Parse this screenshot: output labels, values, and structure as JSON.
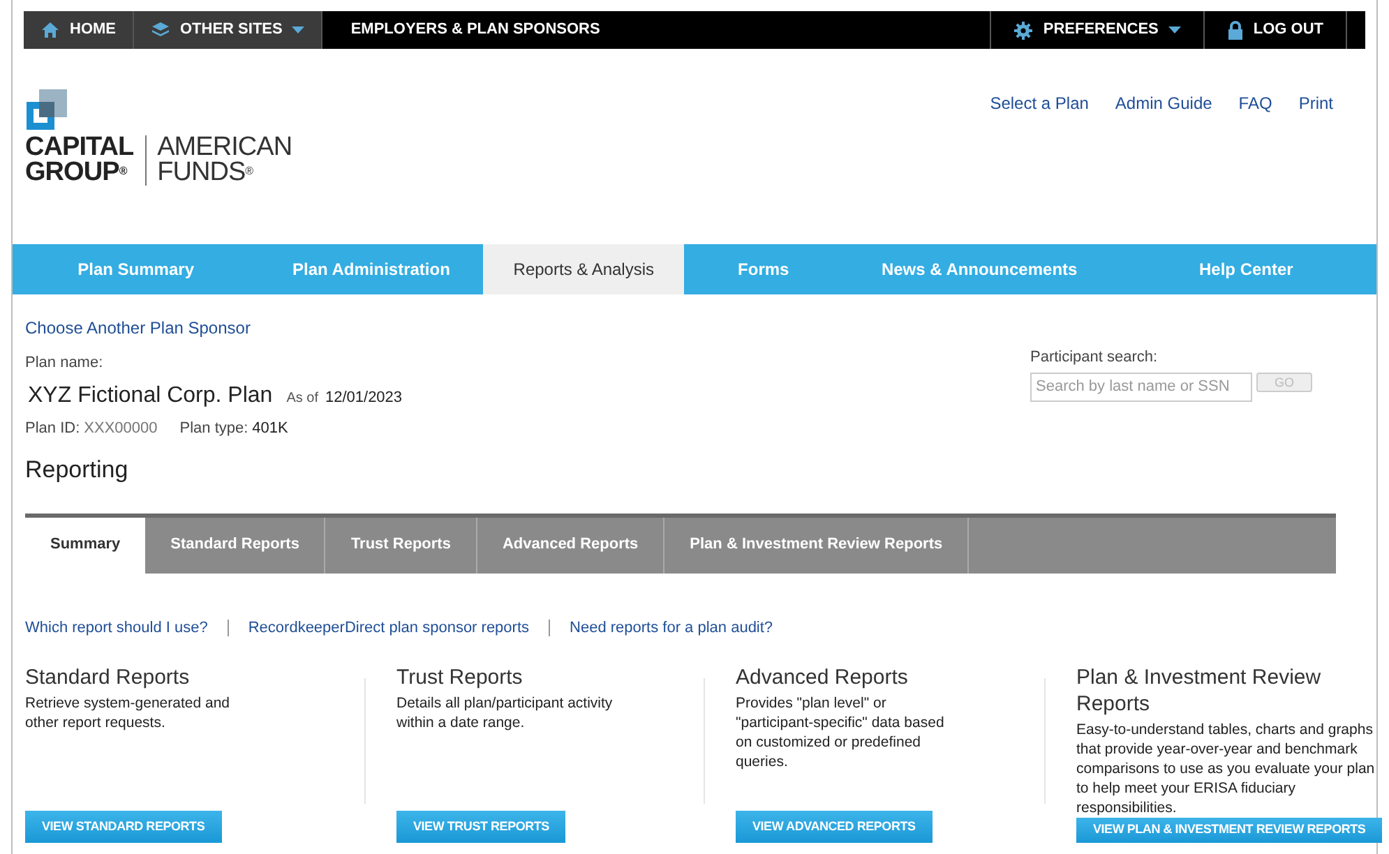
{
  "top_bar": {
    "left_items": [
      {
        "label": "HOME",
        "kind": "home",
        "dropdown": false
      },
      {
        "label": "OTHER SITES",
        "kind": "layers",
        "dropdown": true
      }
    ],
    "site_title": "EMPLOYERS & PLAN SPONSORS",
    "right_items": [
      {
        "label": "PREFERENCES",
        "kind": "gear",
        "dropdown": true
      },
      {
        "label": "LOG OUT",
        "kind": "lock",
        "dropdown": false
      }
    ]
  },
  "logo": {
    "line_1": "CAPITAL",
    "line_2": "GROUP",
    "mark": "®",
    "right_1": "AMERICAN",
    "right_2": "FUNDS",
    "right_mark": "®"
  },
  "header_links": [
    "Select a Plan",
    "Admin Guide",
    "FAQ",
    "Print"
  ],
  "main_nav": [
    {
      "label": "Plan Summary",
      "selected": false
    },
    {
      "label": "Plan Administration",
      "selected": false
    },
    {
      "label": "Reports & Analysis",
      "selected": true
    },
    {
      "label": "Forms",
      "selected": false
    },
    {
      "label": "News & Announcements",
      "selected": false
    },
    {
      "label": "Help Center",
      "selected": false
    }
  ],
  "choose_sponsor_link": "Choose Another Plan Sponsor",
  "plan": {
    "name_label": "Plan name:",
    "name": "XYZ Fictional Corp. Plan",
    "as_of_label": "As of",
    "as_of": "12/01/2023",
    "id_label": "Plan ID:",
    "id": "XXX00000",
    "type_label": "Plan type:",
    "type": "401K"
  },
  "participant_search": {
    "label": "Participant search:",
    "placeholder": "Search by last name or SSN",
    "button": "GO",
    "button_disabled": true
  },
  "page_title": "Reporting",
  "report_tabs": [
    {
      "label": "Summary",
      "selected": true
    },
    {
      "label": "Standard Reports",
      "selected": false
    },
    {
      "label": "Trust Reports",
      "selected": false
    },
    {
      "label": "Advanced Reports",
      "selected": false
    },
    {
      "label": "Plan & Investment Review Reports",
      "selected": false
    }
  ],
  "help_links": [
    "Which report should I use?",
    "RecordkeeperDirect plan sponsor reports",
    "Need reports for a plan audit?"
  ],
  "report_cards": [
    {
      "title": "Standard Reports",
      "description": "Retrieve system-generated and other report requests.",
      "button": "VIEW STANDARD REPORTS"
    },
    {
      "title": "Trust Reports",
      "description": "Details all plan/participant activity within a date range.",
      "button": "VIEW TRUST REPORTS"
    },
    {
      "title": "Advanced Reports",
      "description": "Provides \"plan level\" or \"participant-specific\" data based on customized or predefined queries.",
      "button": "VIEW ADVANCED REPORTS"
    },
    {
      "title": "Plan & Investment Review Reports",
      "description": "Easy-to-understand tables, charts and graphs that provide year-over-year and benchmark comparisons to use as you evaluate your plan to help meet your ERISA fiduciary responsibilities.",
      "button": "VIEW PLAN & INVESTMENT REVIEW REPORTS"
    }
  ]
}
